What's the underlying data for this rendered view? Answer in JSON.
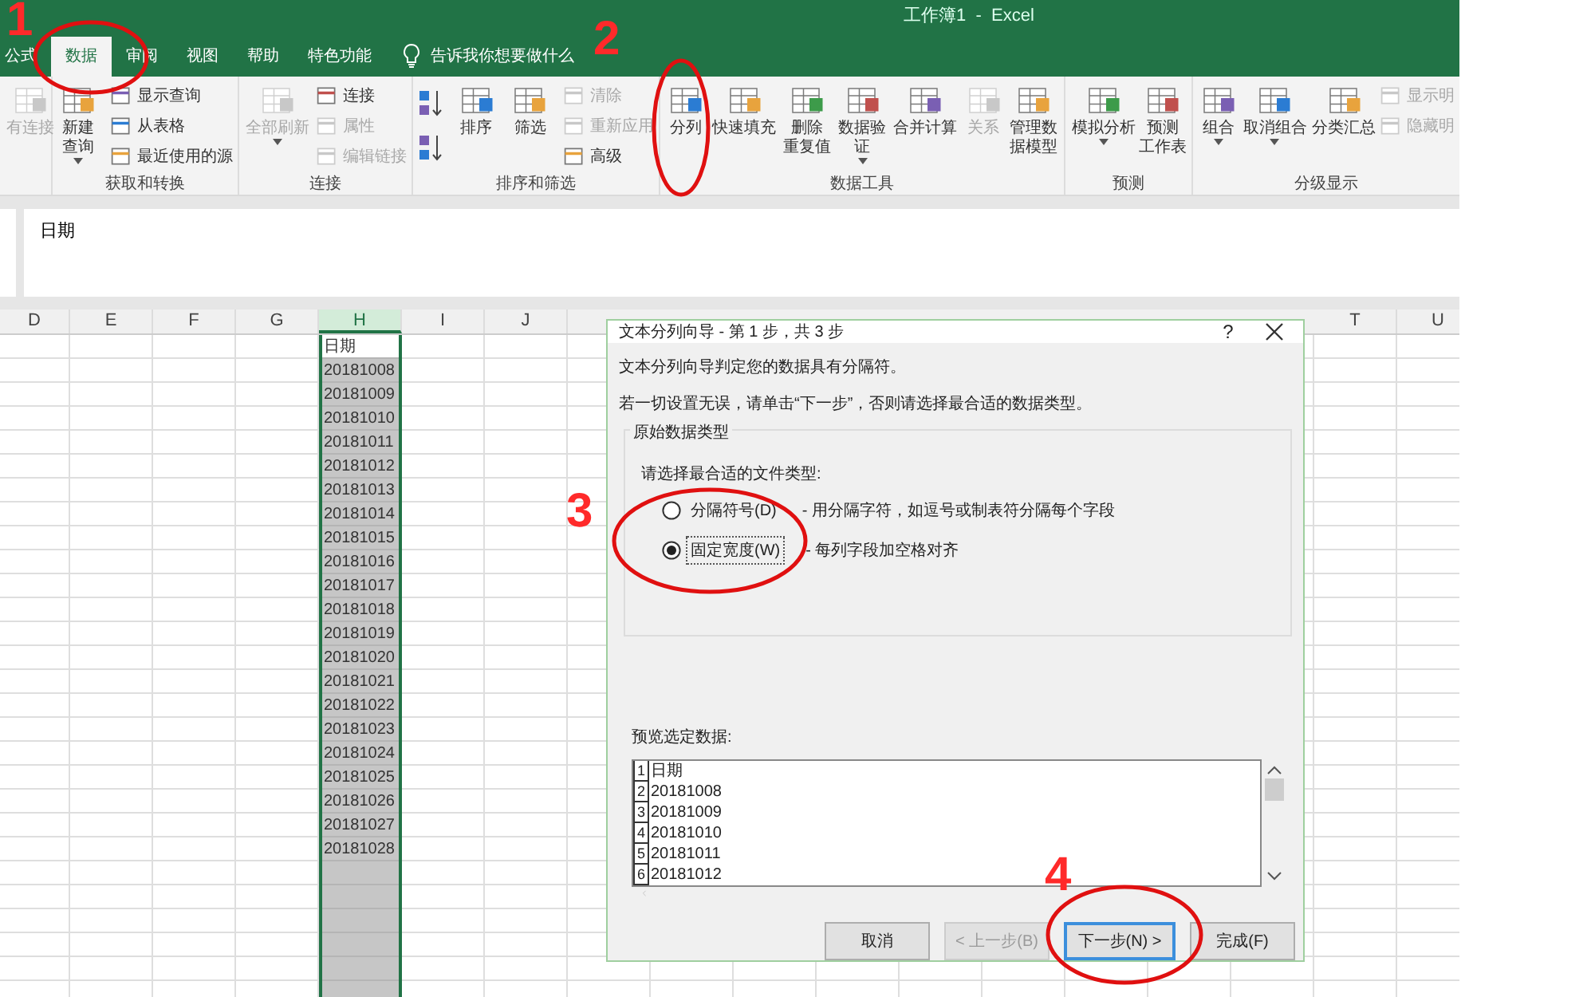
{
  "window": {
    "title": "工作簿1  -  Excel"
  },
  "tabs": [
    {
      "label": "公式",
      "selected": false
    },
    {
      "label": "数据",
      "selected": true
    },
    {
      "label": "审阅",
      "selected": false
    },
    {
      "label": "视图",
      "selected": false
    },
    {
      "label": "帮助",
      "selected": false
    },
    {
      "label": "特色功能",
      "selected": false
    }
  ],
  "tell_me": {
    "placeholder": "告诉我你想要做什么"
  },
  "ribbon": {
    "groups": [
      {
        "items": [
          {
            "kind": "large",
            "lines": [
              "有连接"
            ],
            "disabled": true,
            "dropdown": false
          }
        ]
      },
      {
        "label": "获取和转换",
        "items": [
          {
            "kind": "large",
            "lines": [
              "新建",
              "查询"
            ],
            "disabled": false,
            "dropdown": true
          },
          {
            "kind": "small",
            "label": "显示查询",
            "disabled": false
          },
          {
            "kind": "small",
            "label": "从表格",
            "disabled": false
          },
          {
            "kind": "small",
            "label": "最近使用的源",
            "disabled": false
          }
        ]
      },
      {
        "label": "连接",
        "items": [
          {
            "kind": "large",
            "lines": [
              "全部刷新"
            ],
            "disabled": true,
            "dropdown": true
          },
          {
            "kind": "small",
            "label": "连接",
            "disabled": false
          },
          {
            "kind": "small",
            "label": "属性",
            "disabled": true
          },
          {
            "kind": "small",
            "label": "编辑链接",
            "disabled": true
          }
        ]
      },
      {
        "label": "排序和筛选",
        "items": [
          {
            "kind": "sort",
            "disabled": false
          },
          {
            "kind": "large",
            "lines": [
              "排序"
            ],
            "disabled": false,
            "dropdown": false
          },
          {
            "kind": "large",
            "lines": [
              "筛选"
            ],
            "disabled": false,
            "dropdown": false
          },
          {
            "kind": "small",
            "label": "清除",
            "disabled": true
          },
          {
            "kind": "small",
            "label": "重新应用",
            "disabled": true
          },
          {
            "kind": "small",
            "label": "高级",
            "disabled": false
          }
        ]
      },
      {
        "label": "数据工具",
        "items": [
          {
            "kind": "large",
            "lines": [
              "分列"
            ],
            "disabled": false,
            "dropdown": false
          },
          {
            "kind": "large",
            "lines": [
              "快速填充"
            ],
            "disabled": false,
            "dropdown": false
          },
          {
            "kind": "large",
            "lines": [
              "删除",
              "重复值"
            ],
            "disabled": false,
            "dropdown": false
          },
          {
            "kind": "large",
            "lines": [
              "数据验",
              "证"
            ],
            "disabled": false,
            "dropdown": true
          },
          {
            "kind": "large",
            "lines": [
              "合并计算"
            ],
            "disabled": false,
            "dropdown": false
          },
          {
            "kind": "large",
            "lines": [
              "关系"
            ],
            "disabled": true,
            "dropdown": false
          },
          {
            "kind": "large",
            "lines": [
              "管理数",
              "据模型"
            ],
            "disabled": false,
            "dropdown": false
          }
        ]
      },
      {
        "label": "预测",
        "items": [
          {
            "kind": "large",
            "lines": [
              "模拟分析"
            ],
            "disabled": false,
            "dropdown": true
          },
          {
            "kind": "large",
            "lines": [
              "预测",
              "工作表"
            ],
            "disabled": false,
            "dropdown": false
          }
        ]
      },
      {
        "label": "分级显示",
        "items": [
          {
            "kind": "large",
            "lines": [
              "组合"
            ],
            "disabled": false,
            "dropdown": true
          },
          {
            "kind": "large",
            "lines": [
              "取消组合"
            ],
            "disabled": false,
            "dropdown": true
          },
          {
            "kind": "large",
            "lines": [
              "分类汇总"
            ],
            "disabled": false,
            "dropdown": false
          },
          {
            "kind": "small",
            "label": "显示明",
            "disabled": true
          },
          {
            "kind": "small",
            "label": "隐藏明",
            "disabled": true
          }
        ]
      }
    ]
  },
  "formula_bar": {
    "value": "日期"
  },
  "sheet": {
    "columns_left": [
      {
        "label": "D",
        "selected": false
      },
      {
        "label": "E",
        "selected": false
      },
      {
        "label": "F",
        "selected": false
      },
      {
        "label": "G",
        "selected": false
      },
      {
        "label": "H",
        "selected": true
      },
      {
        "label": "I",
        "selected": false
      },
      {
        "label": "J",
        "selected": false
      }
    ],
    "columns_right": [
      {
        "label": "T",
        "selected": false
      },
      {
        "label": "U",
        "selected": false
      }
    ],
    "column_h_cells": [
      {
        "value": "日期",
        "active": true
      },
      {
        "value": "20181008",
        "active": false
      },
      {
        "value": "20181009",
        "active": false
      },
      {
        "value": "20181010",
        "active": false
      },
      {
        "value": "20181011",
        "active": false
      },
      {
        "value": "20181012",
        "active": false
      },
      {
        "value": "20181013",
        "active": false
      },
      {
        "value": "20181014",
        "active": false
      },
      {
        "value": "20181015",
        "active": false
      },
      {
        "value": "20181016",
        "active": false
      },
      {
        "value": "20181017",
        "active": false
      },
      {
        "value": "20181018",
        "active": false
      },
      {
        "value": "20181019",
        "active": false
      },
      {
        "value": "20181020",
        "active": false
      },
      {
        "value": "20181021",
        "active": false
      },
      {
        "value": "20181022",
        "active": false
      },
      {
        "value": "20181023",
        "active": false
      },
      {
        "value": "20181024",
        "active": false
      },
      {
        "value": "20181025",
        "active": false
      },
      {
        "value": "20181026",
        "active": false
      },
      {
        "value": "20181027",
        "active": false
      },
      {
        "value": "20181028",
        "active": false
      }
    ]
  },
  "dialog": {
    "title": "文本分列向导 - 第 1 步，共 3 步",
    "help": "?",
    "lines": [
      "文本分列向导判定您的数据具有分隔符。",
      "若一切设置无误，请单击“下一步”，否则请选择最合适的数据类型。"
    ],
    "group": {
      "legend": "原始数据类型",
      "prompt": "请选择最合适的文件类型:",
      "options": [
        {
          "label": "分隔符号(D)",
          "description": "- 用分隔字符，如逗号或制表符分隔每个字段",
          "selected": false
        },
        {
          "label": "固定宽度(W)",
          "description": "- 每列字段加空格对齐",
          "selected": true
        }
      ]
    },
    "preview": {
      "label": "预览选定数据:",
      "rows": [
        {
          "number": "1",
          "text": "日期"
        },
        {
          "number": "2",
          "text": "20181008"
        },
        {
          "number": "3",
          "text": "20181009"
        },
        {
          "number": "4",
          "text": "20181010"
        },
        {
          "number": "5",
          "text": "20181011"
        },
        {
          "number": "6",
          "text": "20181012"
        }
      ]
    },
    "buttons": [
      {
        "label": "取消",
        "disabled": false,
        "default": false
      },
      {
        "label": "< 上一步(B)",
        "disabled": true,
        "default": false
      },
      {
        "label": "下一步(N) >",
        "disabled": false,
        "default": true
      },
      {
        "label": "完成(F)",
        "disabled": false,
        "default": false
      }
    ]
  },
  "annotations": [
    "1",
    "2",
    "3",
    "4"
  ]
}
